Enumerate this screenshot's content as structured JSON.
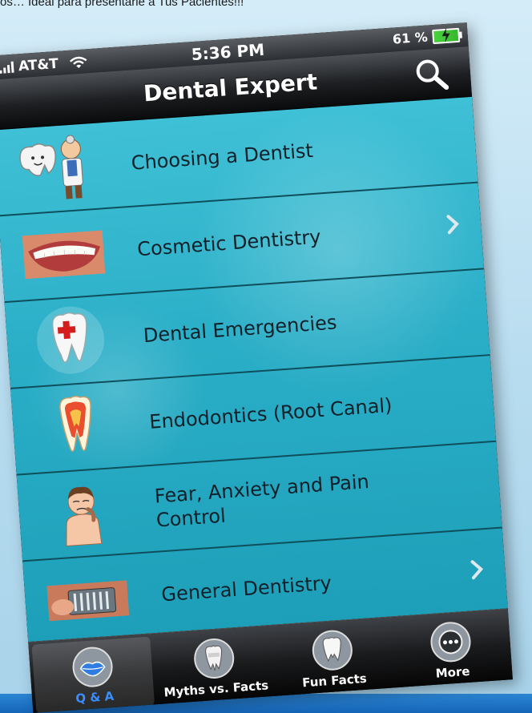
{
  "caption": "os… Ideal para presentarle a Tus Pacientes!!!",
  "status_bar": {
    "carrier": "AT&T",
    "time": "5:36 PM",
    "battery": "61 %"
  },
  "nav": {
    "title": "Dental Expert"
  },
  "list": {
    "items": [
      {
        "label": "Choosing a Dentist"
      },
      {
        "label": "Cosmetic Dentistry"
      },
      {
        "label": "Dental Emergencies"
      },
      {
        "label": "Endodontics (Root Canal)"
      },
      {
        "label": "Fear, Anxiety and Pain Control"
      },
      {
        "label": "General Dentistry"
      }
    ]
  },
  "tabs": [
    {
      "label": "Q & A"
    },
    {
      "label": "Myths vs. Facts"
    },
    {
      "label": "Fun Facts"
    },
    {
      "label": "More"
    }
  ],
  "colors": {
    "list_background": "#2aaec7",
    "active_tab_label": "#3a8dff"
  }
}
